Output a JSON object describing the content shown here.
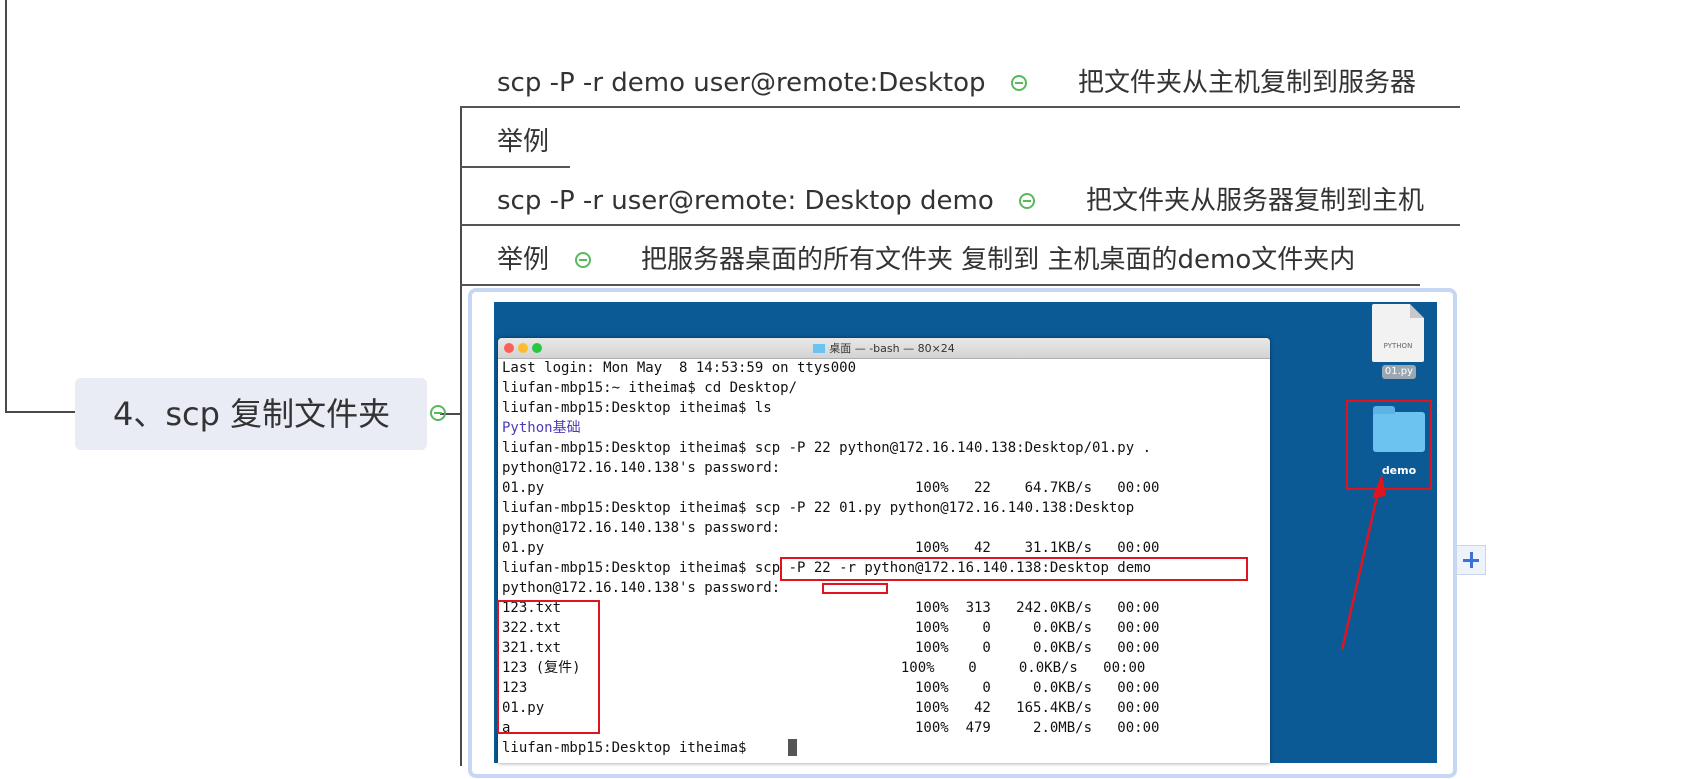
{
  "main_node": {
    "label": "4、scp 复制文件夹"
  },
  "branches": [
    {
      "command": "scp -P -r demo user@remote:Desktop",
      "note": "把文件夹从主机复制到服务器"
    },
    {
      "label": "举例"
    },
    {
      "command": "scp -P -r user@remote: Desktop demo",
      "note": "把文件夹从服务器复制到主机"
    },
    {
      "label": "举例",
      "note": "把服务器桌面的所有文件夹  复制到   主机桌面的demo文件夹内"
    }
  ],
  "terminal": {
    "title": "桌面 — -bash — 80×24",
    "lines": [
      "Last login: Mon May  8 14:53:59 on ttys000",
      "liufan-mbp15:~ itheima$ cd Desktop/",
      "liufan-mbp15:Desktop itheima$ ls",
      "Python基础",
      "liufan-mbp15:Desktop itheima$ scp -P 22 python@172.16.140.138:Desktop/01.py .",
      "python@172.16.140.138's password:",
      "01.py                                            100%   22    64.7KB/s   00:00",
      "liufan-mbp15:Desktop itheima$ scp -P 22 01.py python@172.16.140.138:Desktop",
      "python@172.16.140.138's password:",
      "01.py                                            100%   42    31.1KB/s   00:00",
      "liufan-mbp15:Desktop itheima$ scp -P 22 -r python@172.16.140.138:Desktop demo",
      "python@172.16.140.138's password:",
      "123.txt                                          100%  313   242.0KB/s   00:00",
      "322.txt                                          100%    0     0.0KB/s   00:00",
      "321.txt                                          100%    0     0.0KB/s   00:00",
      "123 (复件)                                      100%    0     0.0KB/s   00:00",
      "123                                              100%    0     0.0KB/s   00:00",
      "01.py                                            100%   42   165.4KB/s   00:00",
      "a                                                100%  479     2.0MB/s   00:00",
      "liufan-mbp15:Desktop itheima$ "
    ]
  },
  "desktop_icons": {
    "file_label": "PYTHON",
    "file_name": "01.py",
    "folder_name": "demo"
  },
  "colors": {
    "node_bg": "#e9ecf5",
    "collapse_green": "#58b85c",
    "desktop_blue": "#0b5a96",
    "highlight_red": "#e0141e",
    "frame_blue": "#c5d7f2"
  }
}
